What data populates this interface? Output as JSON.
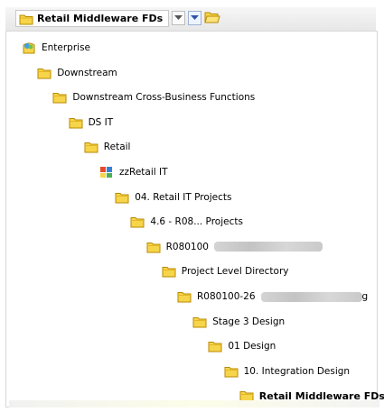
{
  "toolbar": {
    "current_folder": "Retail Middleware FDs",
    "icons": {
      "folder": "folder-icon",
      "dropdown": "dropdown-arrow-icon",
      "up": "up-level-icon",
      "open": "open-folder-icon"
    }
  },
  "tree": [
    {
      "label": "Enterprise",
      "icon": "enterprise-icon"
    },
    {
      "label": "Downstream",
      "icon": "folder-icon"
    },
    {
      "label": "Downstream Cross-Business Functions",
      "icon": "folder-icon"
    },
    {
      "label": "DS IT",
      "icon": "folder-icon"
    },
    {
      "label": "Retail",
      "icon": "folder-icon"
    },
    {
      "label": "zzRetail IT",
      "icon": "workspace-icon"
    },
    {
      "label": "04. Retail IT Projects",
      "icon": "folder-icon"
    },
    {
      "label": "4.6 - R08... Projects",
      "icon": "folder-icon"
    },
    {
      "label": "R080100",
      "icon": "folder-icon",
      "redacted": true
    },
    {
      "label": "Project Level Directory",
      "icon": "folder-icon"
    },
    {
      "label": "R080100-26",
      "icon": "folder-icon",
      "redacted": true,
      "trailing": "g"
    },
    {
      "label": "Stage 3 Design",
      "icon": "folder-icon"
    },
    {
      "label": "01 Design",
      "icon": "folder-icon"
    },
    {
      "label": "10. Integration Design",
      "icon": "folder-icon"
    },
    {
      "label": "Retail Middleware FDs",
      "icon": "folder-icon"
    }
  ],
  "colors": {
    "folder_fill": "#f7d54a",
    "folder_edge": "#b88a00",
    "panel_border": "#d8d8d8"
  }
}
